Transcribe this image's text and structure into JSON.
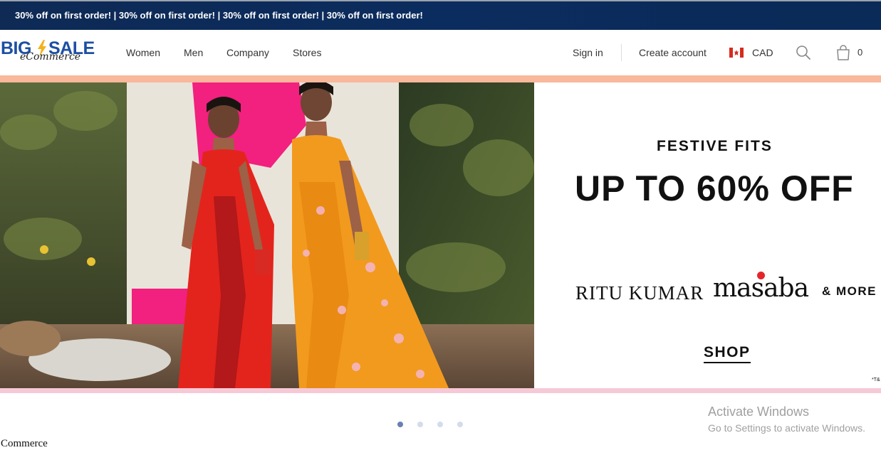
{
  "promo": {
    "text": "30% off on first order! | 30% off on first order! | 30% off on first order! | 30% off on first order!"
  },
  "logo": {
    "big": "BIG",
    "sale": "SALE",
    "sub": "eCommerce"
  },
  "nav": {
    "items": [
      "Women",
      "Men",
      "Company",
      "Stores"
    ]
  },
  "account": {
    "sign_in": "Sign in",
    "create_account": "Create account",
    "currency": "CAD",
    "cart_count": "0"
  },
  "hero": {
    "eyebrow": "FESTIVE FITS",
    "headline": "UP TO 60% OFF",
    "brand_1": "RITU KUMAR",
    "brand_2": "masaba",
    "brand_more": "& MORE",
    "cta": "SHOP",
    "footnote": "*T&"
  },
  "carousel": {
    "active_index": 0,
    "count": 4
  },
  "watermark": {
    "title": "Activate Windows",
    "subtitle": "Go to Settings to activate Windows."
  },
  "footer": {
    "text": "Commerce"
  },
  "colors": {
    "promo_bg": "#0b2c5e",
    "brand_blue": "#1d4fa3",
    "hero_top_band": "#f9b79b",
    "hero_bottom_band": "#f6c9d7"
  },
  "icons": [
    "search-icon",
    "cart-icon",
    "canada-flag-icon",
    "lightning-bolt-icon"
  ]
}
